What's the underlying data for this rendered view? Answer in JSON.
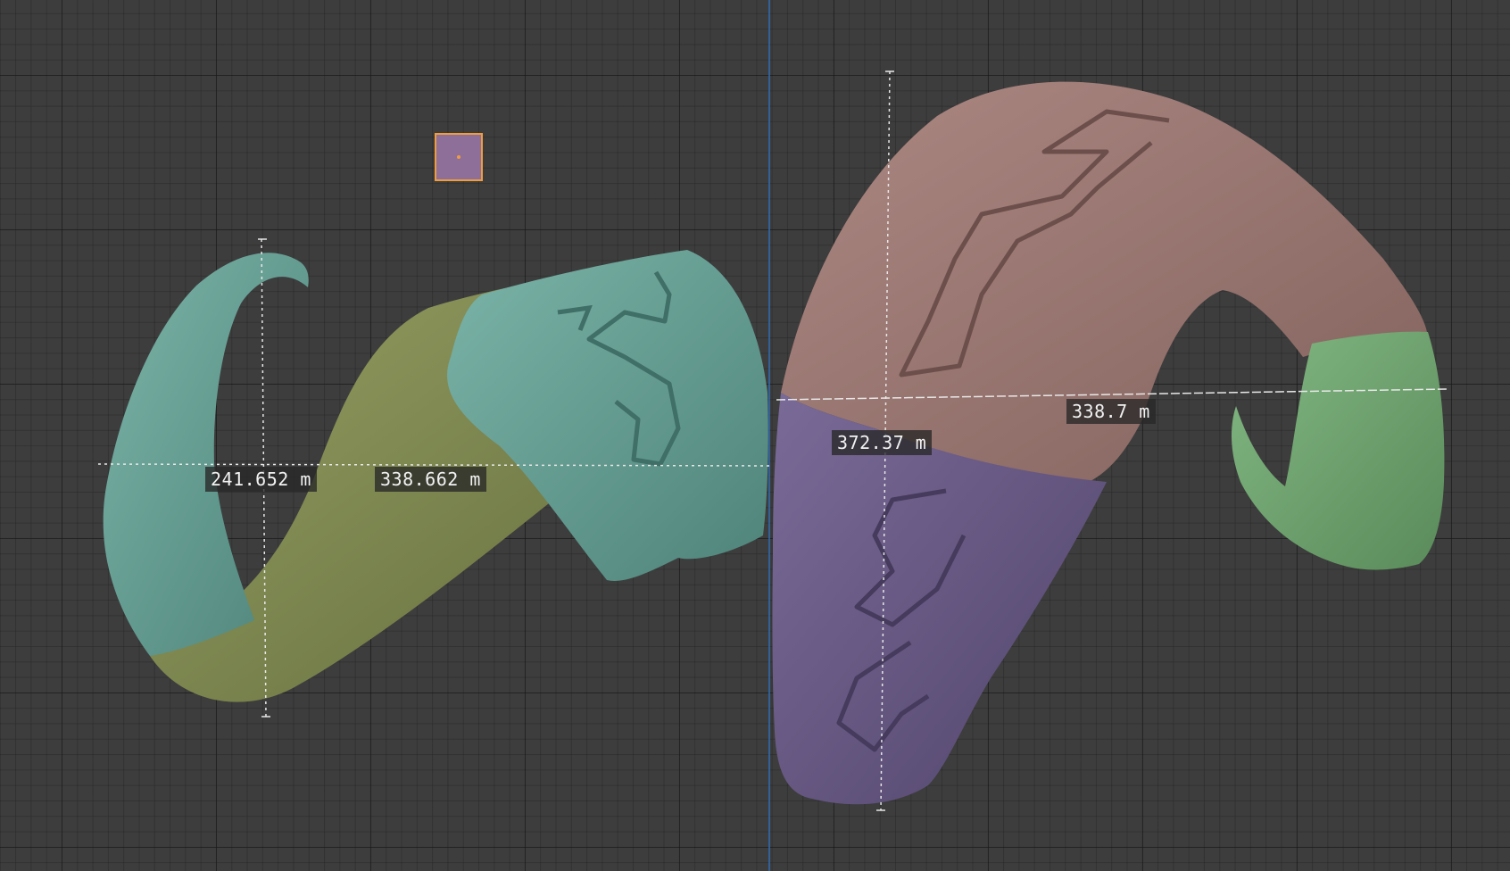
{
  "viewport": {
    "colors": {
      "background": "#3d3d3d",
      "grid": "#2a2a2a",
      "axis_line": "#2f6db5",
      "selection_outline": "#f09d3e",
      "measure_line": "#e6e6e6"
    },
    "objects": [
      {
        "name": "horn-left",
        "parts": [
          "teal-tip",
          "olive-base",
          "teal-cap"
        ],
        "colors": {
          "teal": "#5f9c91",
          "olive": "#7f8a4e"
        }
      },
      {
        "name": "horn-right",
        "parts": [
          "rose-top",
          "violet-bottom",
          "green-tip"
        ],
        "colors": {
          "rose": "#9a7570",
          "violet": "#65577f",
          "green": "#6c9e6c"
        }
      }
    ],
    "empty_object": {
      "icon": "empty-object-icon",
      "color": "#8e6f9a"
    }
  },
  "measurements": [
    {
      "id": "m1",
      "text": "241.652 m"
    },
    {
      "id": "m2",
      "text": "338.662 m"
    },
    {
      "id": "m3",
      "text": "372.37 m"
    },
    {
      "id": "m4",
      "text": "338.7 m"
    }
  ]
}
